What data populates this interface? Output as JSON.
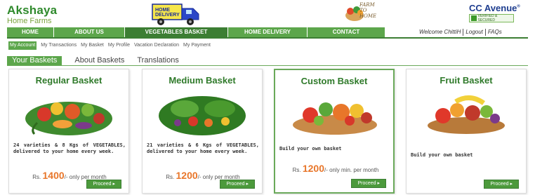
{
  "brand": {
    "name": "Akshaya",
    "sub": "Home Farms"
  },
  "truck": {
    "line1": "HOME",
    "line2": "DELIVERY"
  },
  "stamp": {
    "line1": "FARM",
    "line2": "TO",
    "line3": "HOME"
  },
  "payment": {
    "name": "CC Avenue",
    "badge": "VERIFIED & SECURED"
  },
  "nav": {
    "items": [
      {
        "label": "HOME"
      },
      {
        "label": "ABOUT US"
      },
      {
        "label": "VEGETABLES BASKET"
      },
      {
        "label": "HOME DELIVERY"
      },
      {
        "label": "CONTACT"
      }
    ]
  },
  "user": {
    "welcome": "Welcome ChittiH",
    "logout": "Logout",
    "faqs": "FAQs"
  },
  "subnav": {
    "items": [
      {
        "label": "My Account"
      },
      {
        "label": "My Transactions"
      },
      {
        "label": "My Basket"
      },
      {
        "label": "My Profile"
      },
      {
        "label": "Vacation Declaration"
      },
      {
        "label": "My Payment"
      }
    ]
  },
  "tabs": {
    "items": [
      {
        "label": "Your Baskets"
      },
      {
        "label": "About Baskets"
      },
      {
        "label": "Translations"
      }
    ]
  },
  "cards": [
    {
      "title": "Regular Basket",
      "desc": "24 varieties & 8 Kgs of VEGETABLES, delivered to your home every week.",
      "price_prefix": "Rs.",
      "price": "1400",
      "price_suffix": "/- only per month",
      "button": "Proceed ▸"
    },
    {
      "title": "Medium Basket",
      "desc": "21 varieties & 6 Kgs of VEGETABLES, delivered to your home every week.",
      "price_prefix": "Rs.",
      "price": "1200",
      "price_suffix": "/- only per month",
      "button": "Proceed ▸"
    },
    {
      "title": "Custom Basket",
      "desc": "Build your own basket",
      "price_prefix": "Rs.",
      "price": "1200",
      "price_suffix": "/- only min. per month",
      "button": "Proceed ▸"
    },
    {
      "title": "Fruit Basket",
      "desc": "Build your own basket",
      "button": "Proceed ▸"
    }
  ],
  "colors": {
    "primary_green": "#5ca64b",
    "dark_green": "#3c7e33",
    "price_orange": "#e8762a",
    "title_green": "#2f7a2a"
  }
}
